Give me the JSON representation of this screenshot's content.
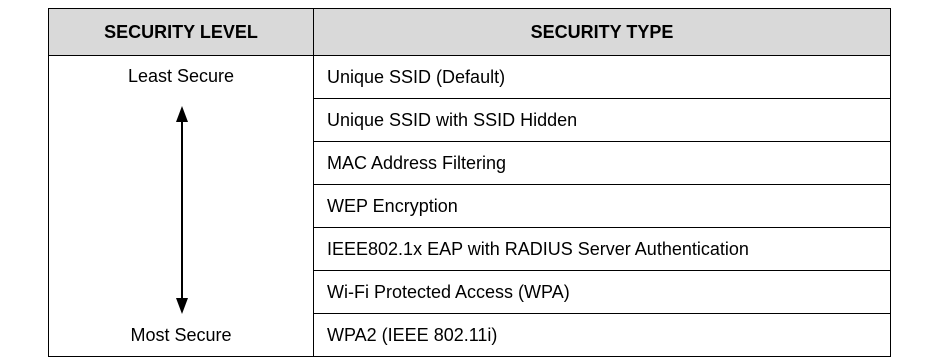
{
  "table": {
    "headers": {
      "level": "SECURITY LEVEL",
      "type": "SECURITY TYPE"
    },
    "level_top": "Least Secure",
    "level_bottom": "Most Secure",
    "arrow_icon": "double-headed-vertical-arrow-icon",
    "rows": [
      "Unique SSID (Default)",
      "Unique SSID with SSID Hidden",
      "MAC Address Filtering",
      "WEP Encryption",
      "IEEE802.1x EAP with RADIUS Server Authentication",
      "Wi-Fi Protected Access (WPA)",
      "WPA2 (IEEE 802.11i)"
    ],
    "header_bg": "#d9d9d9"
  }
}
